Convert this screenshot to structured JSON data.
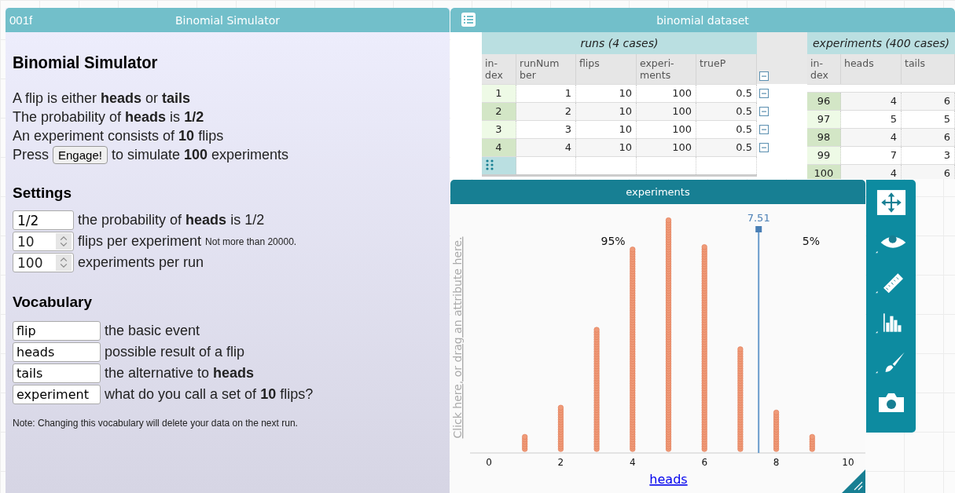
{
  "simulator": {
    "tag": "001f",
    "title": "Binomial Simulator",
    "heading": "Binomial Simulator",
    "intro": [
      "A flip is either **heads** or **tails**",
      "The probability of **heads** is **1/2**",
      "An experiment consists of **10** flips"
    ],
    "press": {
      "before": "Press",
      "button": "Engage!",
      "after": "to simulate **100** experiments"
    },
    "settings": {
      "heading": "Settings",
      "rows": [
        {
          "kind": "text",
          "value": "1/2",
          "label": "the probability of **heads** is 1/2"
        },
        {
          "kind": "spinner",
          "value": "10",
          "label": "flips per experiment",
          "note": "Not more than 20000."
        },
        {
          "kind": "spinner",
          "value": "100",
          "label": "experiments per run"
        }
      ]
    },
    "vocabulary": {
      "heading": "Vocabulary",
      "rows": [
        {
          "value": "flip",
          "label": "the basic event"
        },
        {
          "value": "heads",
          "label": "possible result of a flip"
        },
        {
          "value": "tails",
          "label": "the alternative to **heads**"
        },
        {
          "value": "experiment",
          "label": "what do you call a set of **10** flips?"
        }
      ]
    },
    "note": "Note: Changing this vocabulary will delete your data on the next run."
  },
  "dataset": {
    "title": "binomial dataset",
    "runs": {
      "title": "runs (4 cases)",
      "columns": [
        "in-\ndex",
        "runNum\nber",
        "flips",
        "experi-\nments",
        "trueP"
      ],
      "rows": [
        [
          "1",
          "1",
          "10",
          "100",
          "0.5"
        ],
        [
          "2",
          "2",
          "10",
          "100",
          "0.5"
        ],
        [
          "3",
          "3",
          "10",
          "100",
          "0.5"
        ],
        [
          "4",
          "4",
          "10",
          "100",
          "0.5"
        ]
      ]
    },
    "experiments": {
      "title": "experiments (400 cases)",
      "columns": [
        "in-\ndex",
        "heads",
        "tails"
      ],
      "rows": [
        [
          "96",
          "4",
          "6"
        ],
        [
          "97",
          "5",
          "5"
        ],
        [
          "98",
          "4",
          "6"
        ],
        [
          "99",
          "7",
          "3"
        ],
        [
          "100",
          "4",
          "6"
        ]
      ]
    }
  },
  "graph": {
    "title": "experiments",
    "y_placeholder": "Click here, or drag an attribute here.",
    "x_axis": {
      "label": "heads",
      "ticks": [
        "0",
        "2",
        "4",
        "6",
        "8",
        "10"
      ]
    },
    "movable_value": {
      "label": "7.51"
    },
    "percent_labels": [
      "95%",
      "5%"
    ]
  }
}
